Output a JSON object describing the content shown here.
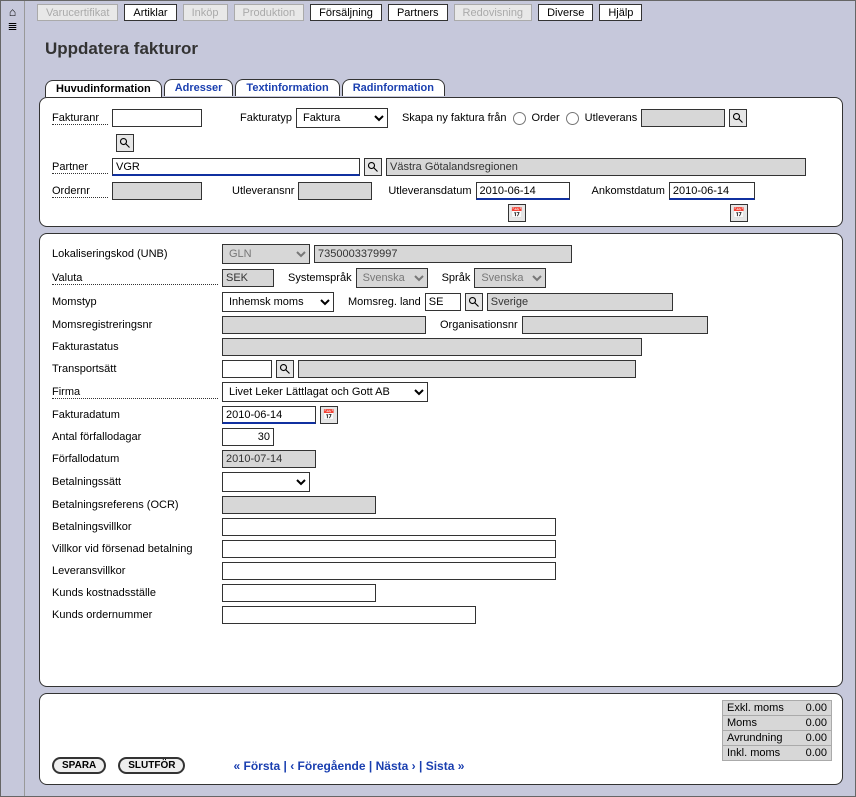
{
  "menu": {
    "varucertifikat": "Varucertifikat",
    "artiklar": "Artiklar",
    "inkop": "Inköp",
    "produktion": "Produktion",
    "forsaljning": "Försäljning",
    "partners": "Partners",
    "redovisning": "Redovisning",
    "diverse": "Diverse",
    "hjalp": "Hjälp"
  },
  "page_title": "Uppdatera fakturor",
  "tabs": {
    "huvudinformation": "Huvudinformation",
    "adresser": "Adresser",
    "textinformation": "Textinformation",
    "radinformation": "Radinformation"
  },
  "head": {
    "fakturanr_label": "Fakturanr",
    "fakturanr_value": "",
    "fakturatyp_label": "Fakturatyp",
    "fakturatyp_value": "Faktura",
    "skapa_label": "Skapa ny faktura från",
    "order_label": "Order",
    "utleverans_label": "Utleverans",
    "partner_label": "Partner",
    "partner_code": "VGR",
    "partner_name": "Västra Götalandsregionen",
    "ordernr_label": "Ordernr",
    "ordernr_value": "",
    "utleveransnr_label": "Utleveransnr",
    "utleveransnr_value": "",
    "utleveransdatum_label": "Utleveransdatum",
    "utleveransdatum_value": "2010-06-14",
    "ankomstdatum_label": "Ankomstdatum",
    "ankomstdatum_value": "2010-06-14"
  },
  "body": {
    "lokaliseringskod_label": "Lokaliseringskod (UNB)",
    "lokaliseringskod_type": "GLN",
    "lokaliseringskod_value": "7350003379997",
    "valuta_label": "Valuta",
    "valuta_value": "SEK",
    "systemsprak_label": "Systemspråk",
    "systemsprak_value": "Svenska",
    "sprak_label": "Språk",
    "sprak_value": "Svenska",
    "momstyp_label": "Momstyp",
    "momstyp_value": "Inhemsk moms",
    "momsreg_land_label": "Momsreg. land",
    "momsreg_land_code": "SE",
    "momsreg_land_name": "Sverige",
    "momsregistreringsnr_label": "Momsregistreringsnr",
    "momsregistreringsnr_value": "",
    "organisationsnr_label": "Organisationsnr",
    "organisationsnr_value": "",
    "fakturastatus_label": "Fakturastatus",
    "fakturastatus_value": "",
    "transportsatt_label": "Transportsätt",
    "transportsatt_code": "",
    "transportsatt_name": "",
    "firma_label": "Firma",
    "firma_value": "Livet Leker Lättlagat och Gott AB",
    "fakturadatum_label": "Fakturadatum",
    "fakturadatum_value": "2010-06-14",
    "antal_forfallodagar_label": "Antal förfallodagar",
    "antal_forfallodagar_value": "30",
    "forfallodatum_label": "Förfallodatum",
    "forfallodatum_value": "2010-07-14",
    "betalningssatt_label": "Betalningssätt",
    "betalningssatt_value": "",
    "betalningsreferens_label": "Betalningsreferens (OCR)",
    "betalningsreferens_value": "",
    "betalningsvillkor_label": "Betalningsvillkor",
    "betalningsvillkor_value": "",
    "villkor_forsenad_label": "Villkor vid försenad betalning",
    "villkor_forsenad_value": "",
    "leveransvillkor_label": "Leveransvillkor",
    "leveransvillkor_value": "",
    "kunds_kostnadsstalle_label": "Kunds kostnadsställe",
    "kunds_kostnadsstalle_value": "",
    "kunds_ordernummer_label": "Kunds ordernummer",
    "kunds_ordernummer_value": ""
  },
  "footer": {
    "spara": "SPARA",
    "slutfor": "SLUTFÖR",
    "forsta": "« Första",
    "foregaende": "‹ Föregående",
    "nasta": "Nästa ›",
    "sista": "Sista »",
    "sep": " | ",
    "totals": {
      "exkl_moms_label": "Exkl. moms",
      "exkl_moms_value": "0.00",
      "moms_label": "Moms",
      "moms_value": "0.00",
      "avrundning_label": "Avrundning",
      "avrundning_value": "0.00",
      "inkl_moms_label": "Inkl. moms",
      "inkl_moms_value": "0.00"
    }
  }
}
